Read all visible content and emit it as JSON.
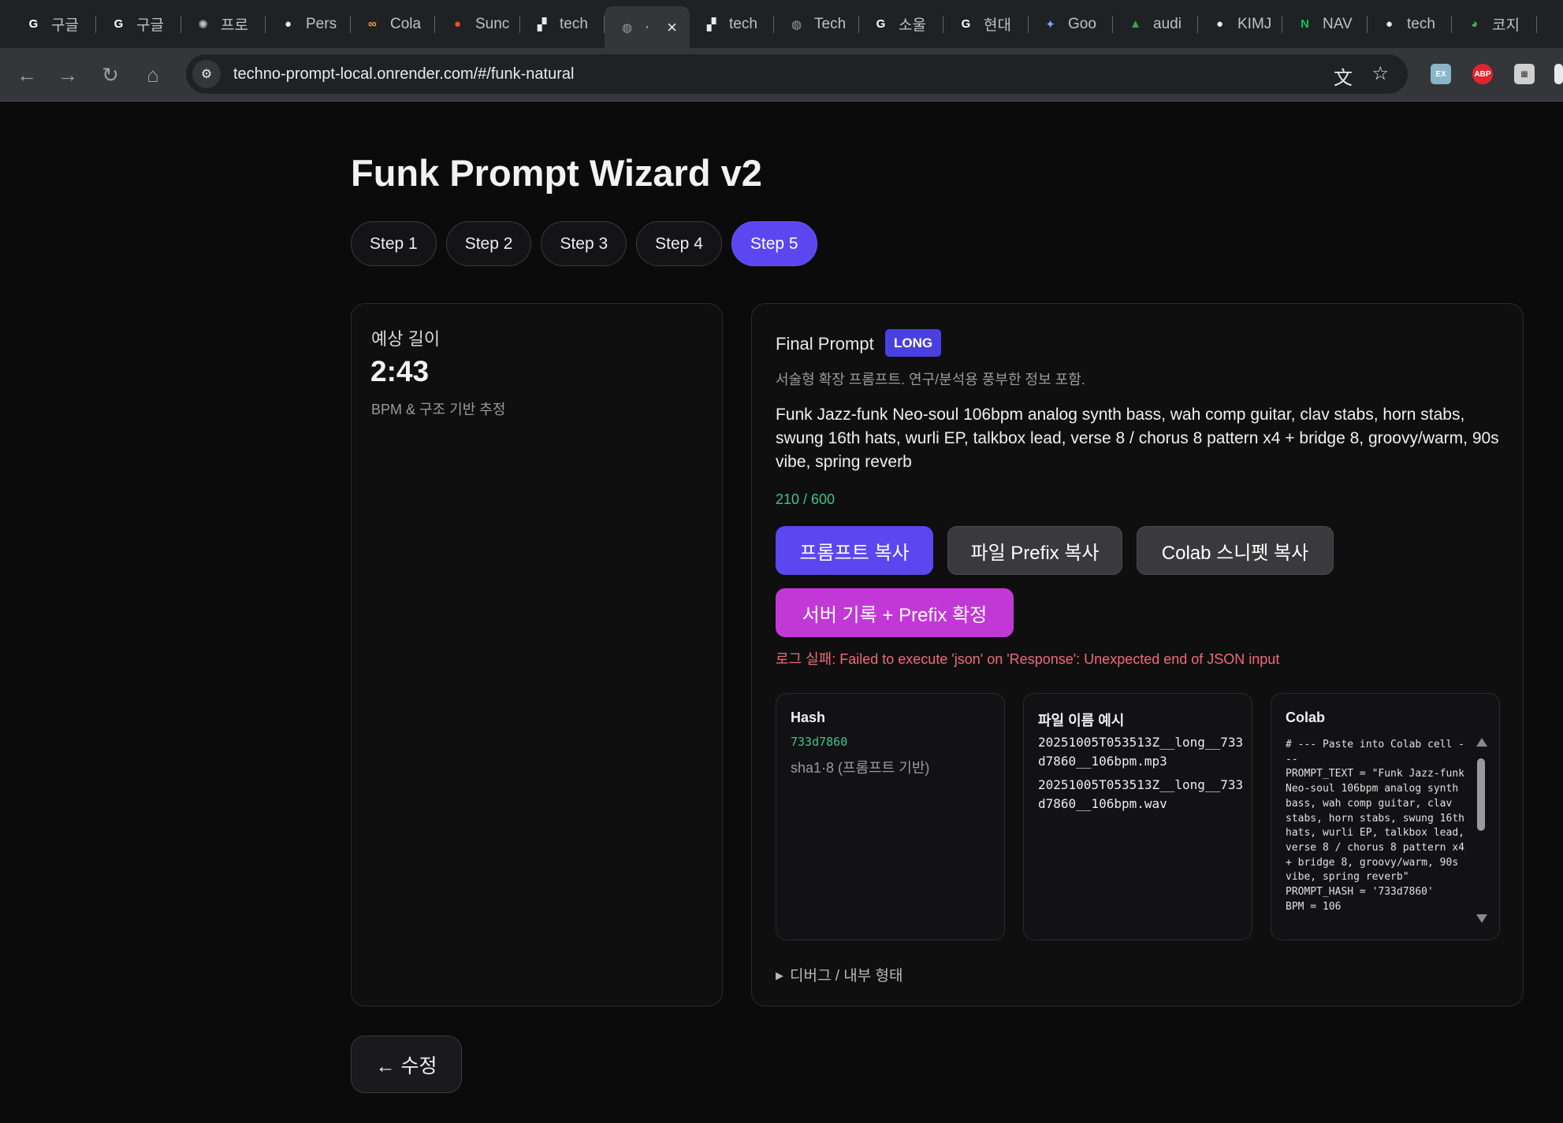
{
  "browser": {
    "tabs": [
      {
        "label": "구글",
        "favicon": "G",
        "fav_color": "#ffffff"
      },
      {
        "label": "구글",
        "favicon": "G",
        "fav_color": "#ffffff"
      },
      {
        "label": "프로",
        "favicon": "✺",
        "fav_color": "#bdc1c6"
      },
      {
        "label": "Pers",
        "favicon": "●",
        "fav_color": "#e8eaed"
      },
      {
        "label": "Cola",
        "favicon": "∞",
        "fav_color": "#f9ab00"
      },
      {
        "label": "Sunc",
        "favicon": "●",
        "fav_color": "#f0502d"
      },
      {
        "label": "tech",
        "favicon": "▞",
        "fav_color": "#e8eaed"
      },
      {
        "label": "·",
        "favicon": "◍",
        "fav_color": "#9aa0a6",
        "active": true
      },
      {
        "label": "tech",
        "favicon": "▞",
        "fav_color": "#e8eaed"
      },
      {
        "label": "Tech",
        "favicon": "◍",
        "fav_color": "#9aa0a6"
      },
      {
        "label": "소울",
        "favicon": "G",
        "fav_color": "#ffffff"
      },
      {
        "label": "현대",
        "favicon": "G",
        "fav_color": "#ffffff"
      },
      {
        "label": "Goo",
        "favicon": "✦",
        "fav_color": "#7aa7ff"
      },
      {
        "label": "audi",
        "favicon": "▲",
        "fav_color": "#34a853"
      },
      {
        "label": "KIMJ",
        "favicon": "●",
        "fav_color": "#e8eaed"
      },
      {
        "label": "NAV",
        "favicon": "N",
        "fav_color": "#03c75a"
      },
      {
        "label": "tech",
        "favicon": "●",
        "fav_color": "#e8eaed"
      },
      {
        "label": "코지",
        "favicon": "◕",
        "fav_color": "#3fb950"
      }
    ],
    "url": "techno-prompt-local.onrender.com/#/funk-natural",
    "icons": {
      "back": "arrow-left-icon",
      "forward": "arrow-right-icon",
      "reload": "reload-icon",
      "home": "home-icon",
      "translate": "translate-icon",
      "bookmark": "star-icon"
    }
  },
  "app": {
    "title": "Funk Prompt Wizard v2",
    "steps": [
      "Step 1",
      "Step 2",
      "Step 3",
      "Step 4",
      "Step 5"
    ],
    "active_step": 5,
    "length_card": {
      "label": "예상 길이",
      "value": "2:43",
      "sub": "BPM & 구조 기반 추정"
    },
    "final": {
      "title": "Final Prompt",
      "badge": "LONG",
      "desc": "서술형 확장 프롬프트. 연구/분석용 풍부한 정보 포함.",
      "prompt": "Funk Jazz-funk Neo-soul 106bpm analog synth bass, wah comp guitar, clav stabs, horn stabs, swung 16th hats, wurli EP, talkbox lead, verse 8 / chorus 8 pattern x4 + bridge 8, groovy/warm, 90s vibe, spring reverb",
      "count": "210 / 600",
      "buttons": {
        "copy_prompt": "프롬프트 복사",
        "copy_prefix": "파일 Prefix 복사",
        "copy_colab": "Colab 스니펫 복사",
        "server_log": "서버 기록 + Prefix 확정"
      },
      "error": "로그 실패: Failed to execute 'json' on 'Response': Unexpected end of JSON input",
      "hash": {
        "title": "Hash",
        "value": "733d7860",
        "sub": "sha1·8 (프롬프트 기반)"
      },
      "filenames": {
        "title": "파일 이름 예시",
        "mp3": "20251005T053513Z__long__733d7860__106bpm.mp3",
        "wav": "20251005T053513Z__long__733d7860__106bpm.wav"
      },
      "colab": {
        "title": "Colab",
        "code": "# --- Paste into Colab cell ---\nPROMPT_TEXT = \"Funk Jazz-funk Neo-soul 106bpm analog synth bass, wah comp guitar, clav stabs, horn stabs, swung 16th hats, wurli EP, talkbox lead, verse 8 / chorus 8 pattern x4 + bridge 8, groovy/warm, 90s vibe, spring reverb\"\nPROMPT_HASH = '733d7860'\nBPM = 106"
      },
      "debug": "디버그 / 내부 형태"
    },
    "back": "← 수정"
  }
}
